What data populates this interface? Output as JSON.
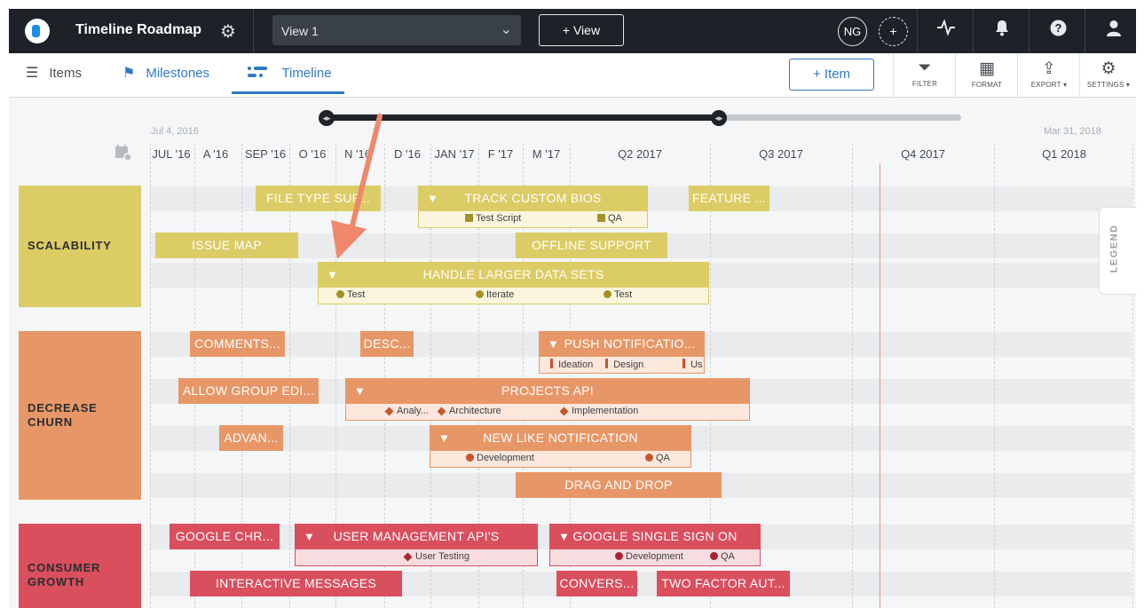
{
  "header": {
    "title": "Timeline Roadmap",
    "view_name": "View 1",
    "add_view_label": "+ View",
    "user_initials": "NG"
  },
  "toolbar": {
    "tabs": [
      {
        "label": "Items",
        "icon": "list-icon"
      },
      {
        "label": "Milestones",
        "icon": "flag-icon"
      },
      {
        "label": "Timeline",
        "icon": "timeline-icon",
        "active": true
      }
    ],
    "add_item_label": "+ Item",
    "tools": [
      {
        "label": "FILTER",
        "icon": "filter-icon"
      },
      {
        "label": "FORMAT",
        "icon": "format-icon"
      },
      {
        "label": "EXPORT ▾",
        "icon": "export-icon"
      },
      {
        "label": "SETTINGS ▾",
        "icon": "gear-icon"
      }
    ]
  },
  "timeline": {
    "range_start": "Jul 4, 2016",
    "range_end": "Mar 31, 2018",
    "headers": [
      "JUL '16",
      "A '16",
      "SEP '16",
      "O '16",
      "N '16",
      "D '16",
      "JAN '17",
      "F '17",
      "M '17",
      "Q2 2017",
      "Q3 2017",
      "Q4 2017",
      "Q1 2018"
    ],
    "legend_label": "LEGEND"
  },
  "lanes": [
    {
      "name": "SCALABILITY",
      "color": "#dccc65"
    },
    {
      "name_line1": "DECREASE",
      "name_line2": "CHURN",
      "color": "#e79767"
    },
    {
      "name_line1": "CONSUMER",
      "name_line2": "GROWTH",
      "color": "#d94f5e"
    }
  ],
  "bars": {
    "file_type": "FILE TYPE SUP...",
    "track_bios": "TRACK CUSTOM BIOS",
    "track_bios_subs": [
      "Test Script",
      "QA"
    ],
    "feature": "FEATURE ...",
    "issue_map": "ISSUE MAP",
    "offline": "OFFLINE SUPPORT",
    "larger_data": "HANDLE LARGER DATA SETS",
    "larger_data_subs": [
      "Test",
      "Iterate",
      "Test"
    ],
    "comments": "COMMENTS...",
    "desc": "DESC...",
    "push": "PUSH NOTIFICATIO...",
    "push_subs": [
      "Ideation",
      "Design",
      "Us"
    ],
    "group_edit": "ALLOW GROUP EDI...",
    "projects_api": "PROJECTS API",
    "projects_api_subs": [
      "Analy...",
      "Architecture",
      "Implementation"
    ],
    "advan": "ADVAN...",
    "new_like": "NEW LIKE NOTIFICATION",
    "new_like_subs": [
      "Development",
      "QA"
    ],
    "drag_drop": "DRAG AND DROP",
    "google_chr": "GOOGLE CHR...",
    "user_mgmt": "USER MANAGEMENT API'S",
    "user_mgmt_subs": [
      "User Testing"
    ],
    "google_sso": "GOOGLE SINGLE SIGN ON",
    "google_sso_subs": [
      "Development",
      "QA"
    ],
    "interactive": "INTERACTIVE MESSAGES",
    "convers": "CONVERS...",
    "two_factor": "TWO FACTOR AUT..."
  },
  "colors": {
    "accent": "#2e7bc4",
    "topbar": "#1d2228",
    "scalability": "#dccc65",
    "churn": "#e79767",
    "growth": "#d94f5e",
    "annotation_arrow": "#f0876a"
  }
}
